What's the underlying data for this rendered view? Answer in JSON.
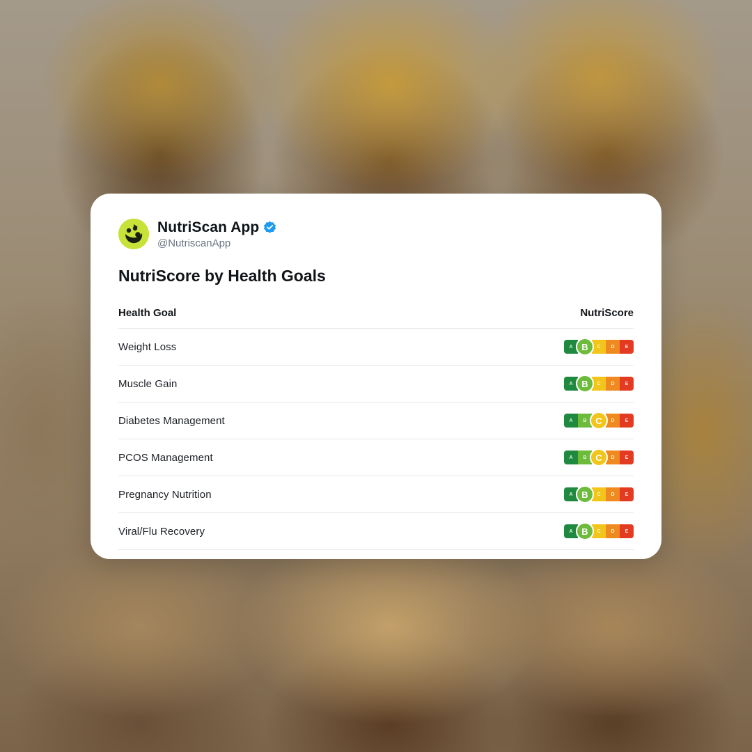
{
  "account": {
    "name": "NutriScan App",
    "handle": "@NutriscanApp",
    "verified": true,
    "verified_icon": "verified-badge-icon",
    "avatar_icon": "nutriscan-logo-icon",
    "colors": {
      "avatar_bg": "#c8e23a",
      "verified": "#1d9bf0"
    }
  },
  "title": "NutriScore by Health Goals",
  "table": {
    "headers": {
      "goal": "Health Goal",
      "score": "NutriScore"
    },
    "grade_letters": [
      "A",
      "B",
      "C",
      "D",
      "E"
    ],
    "grade_colors": [
      "#1f8a3f",
      "#6cbb3a",
      "#f2c51b",
      "#ee8a20",
      "#e33b22"
    ],
    "rows": [
      {
        "goal": "Weight Loss",
        "score": "B"
      },
      {
        "goal": "Muscle Gain",
        "score": "B"
      },
      {
        "goal": "Diabetes Management",
        "score": "C"
      },
      {
        "goal": "PCOS Management",
        "score": "C"
      },
      {
        "goal": "Pregnancy Nutrition",
        "score": "B"
      },
      {
        "goal": "Viral/Flu Recovery",
        "score": "B"
      }
    ]
  }
}
